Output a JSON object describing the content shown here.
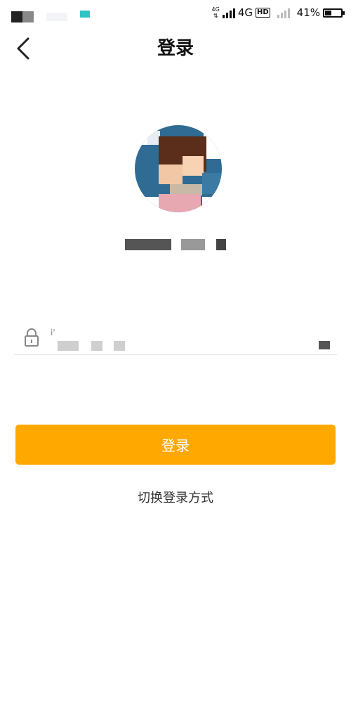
{
  "status_bar": {
    "network_small": "4G",
    "network": "4G",
    "hd_badge": "HD",
    "battery_percent": "41%",
    "battery_level": 0.41
  },
  "header": {
    "title": "登录"
  },
  "password": {
    "placeholder": ""
  },
  "buttons": {
    "login_label": "登录",
    "switch_method_label": "切换登录方式"
  },
  "colors": {
    "accent": "#FFA800",
    "background": "#FFFFFF"
  },
  "icons": {
    "back": "chevron-left-icon",
    "lock": "lock-icon",
    "visibility": "eye-toggle-icon"
  }
}
